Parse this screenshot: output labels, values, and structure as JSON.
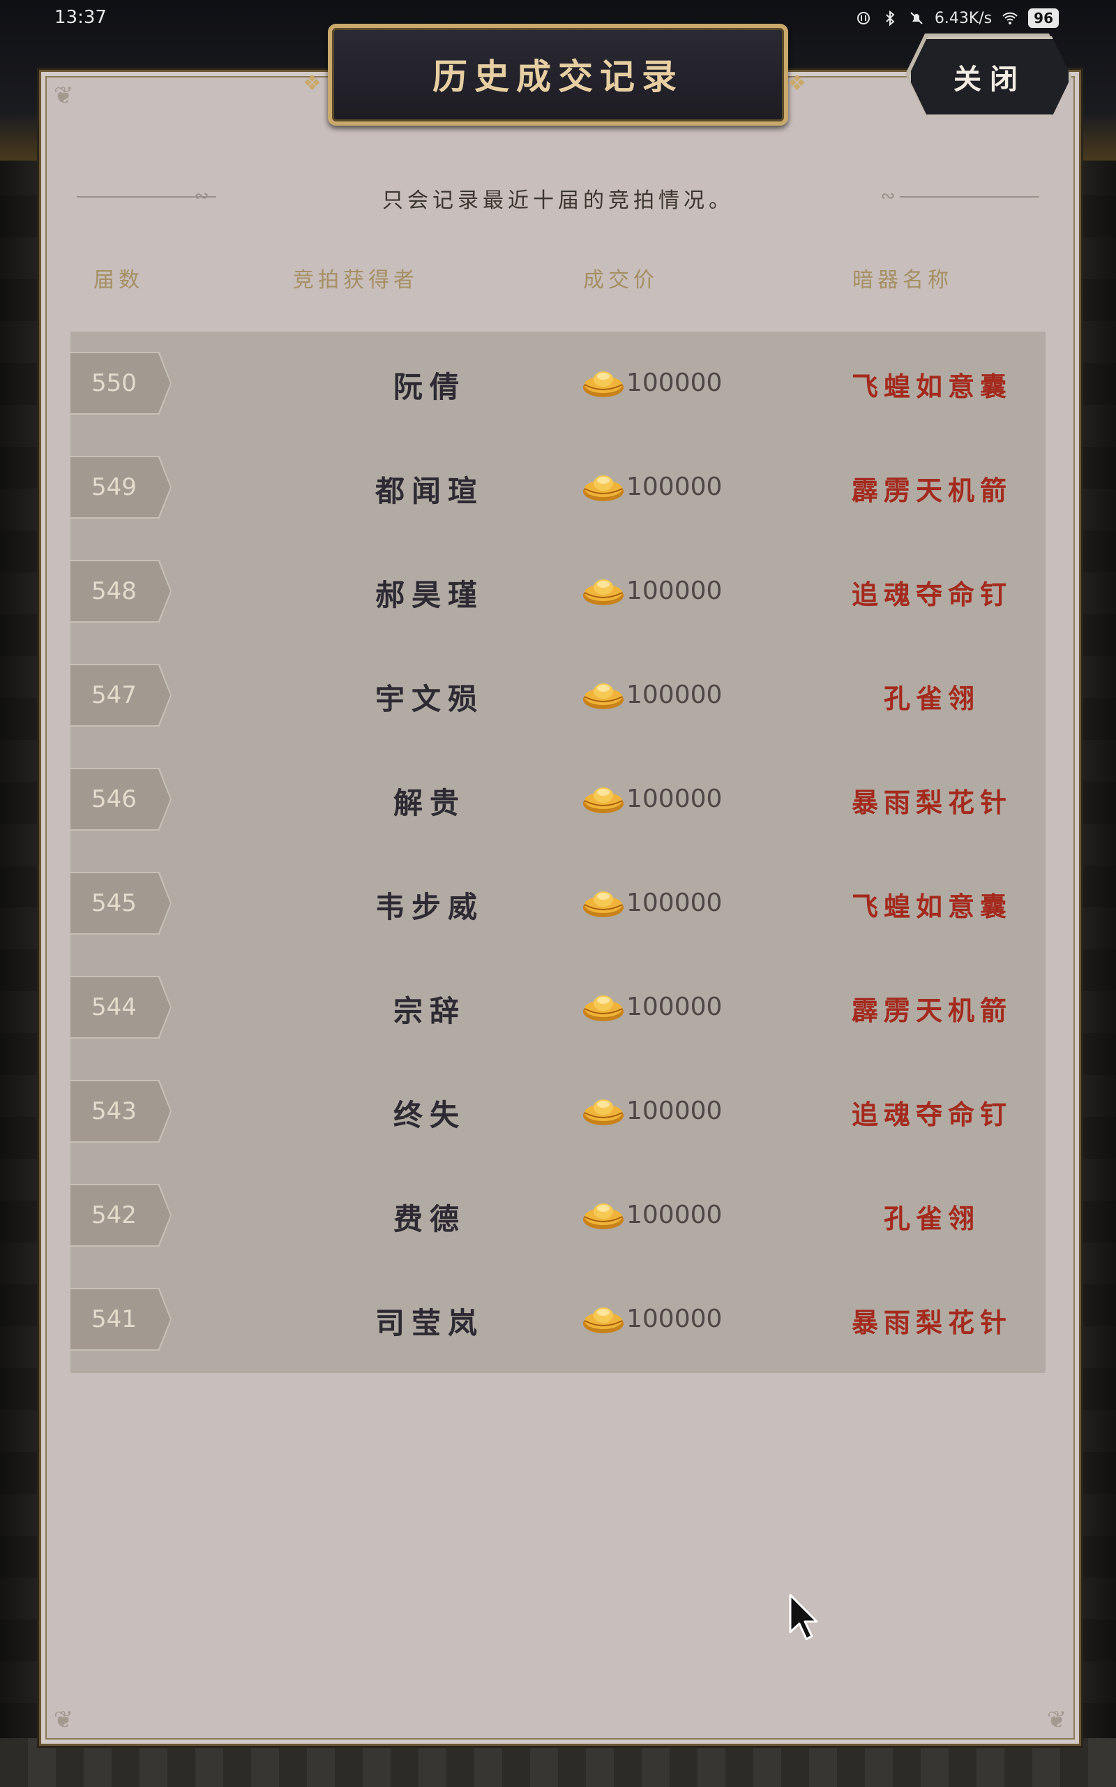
{
  "status_bar": {
    "time": "13:37",
    "network_speed": "6.43K/s",
    "battery": "96"
  },
  "dialog": {
    "title": "历史成交记录",
    "close_label": "关闭",
    "notice": "只会记录最近十届的竞拍情况。"
  },
  "table": {
    "headers": {
      "session": "届数",
      "winner": "竞拍获得者",
      "price": "成交价",
      "weapon": "暗器名称"
    },
    "rows": [
      {
        "session": "550",
        "winner": "阮倩",
        "price": "100000",
        "weapon": "飞蝗如意囊"
      },
      {
        "session": "549",
        "winner": "都闻瑄",
        "price": "100000",
        "weapon": "霹雳天机箭"
      },
      {
        "session": "548",
        "winner": "郝昊瑾",
        "price": "100000",
        "weapon": "追魂夺命钉"
      },
      {
        "session": "547",
        "winner": "宇文殒",
        "price": "100000",
        "weapon": "孔雀翎"
      },
      {
        "session": "546",
        "winner": "解贵",
        "price": "100000",
        "weapon": "暴雨梨花针"
      },
      {
        "session": "545",
        "winner": "韦步威",
        "price": "100000",
        "weapon": "飞蝗如意囊"
      },
      {
        "session": "544",
        "winner": "宗辞",
        "price": "100000",
        "weapon": "霹雳天机箭"
      },
      {
        "session": "543",
        "winner": "终失",
        "price": "100000",
        "weapon": "追魂夺命钉"
      },
      {
        "session": "542",
        "winner": "费德",
        "price": "100000",
        "weapon": "孔雀翎"
      },
      {
        "session": "541",
        "winner": "司莹岚",
        "price": "100000",
        "weapon": "暴雨梨花针"
      }
    ]
  },
  "colors": {
    "panel_bg": "#c8bebb",
    "table_bg": "#b2aba3",
    "weapon_text": "#a42a1e",
    "header_text": "#a58f64",
    "title_gold": "#e7cfa3"
  },
  "icons": {
    "currency": "gold-ingot-icon",
    "cursor": "mouse-pointer-icon"
  }
}
